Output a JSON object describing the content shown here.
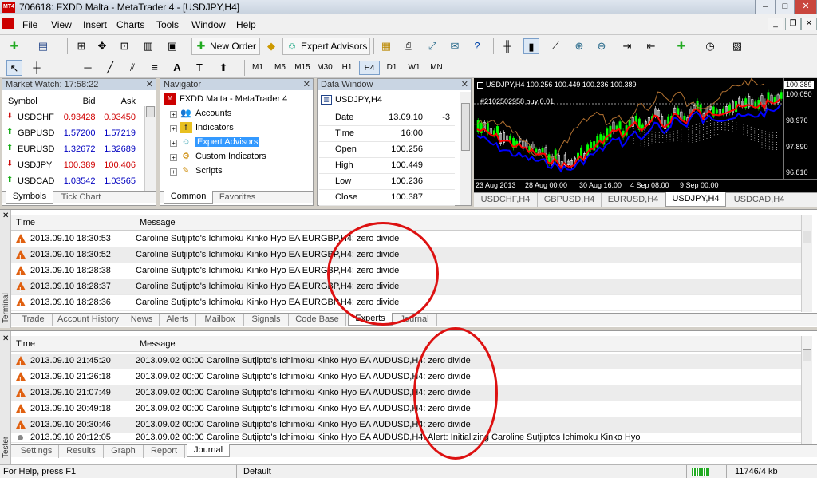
{
  "window": {
    "title": "706618: FXDD Malta - MetaTrader 4 - [USDJPY,H4]",
    "app_logo": "MT4"
  },
  "menu": [
    "File",
    "View",
    "Insert",
    "Charts",
    "Tools",
    "Window",
    "Help"
  ],
  "toolbar": {
    "new_order": "New Order",
    "expert_advisors": "Expert Advisors",
    "timeframes": [
      "M1",
      "M5",
      "M15",
      "M30",
      "H1",
      "H4",
      "D1",
      "W1",
      "MN"
    ],
    "selected_tf": "H4"
  },
  "market_watch": {
    "title": "Market Watch: 17:58:22",
    "headers": [
      "Symbol",
      "Bid",
      "Ask"
    ],
    "rows": [
      {
        "symbol": "USDCHF",
        "bid": "0.93428",
        "ask": "0.93450",
        "dir": "down"
      },
      {
        "symbol": "GBPUSD",
        "bid": "1.57200",
        "ask": "1.57219",
        "dir": "up"
      },
      {
        "symbol": "EURUSD",
        "bid": "1.32672",
        "ask": "1.32689",
        "dir": "up"
      },
      {
        "symbol": "USDJPY",
        "bid": "100.389",
        "ask": "100.406",
        "dir": "down"
      },
      {
        "symbol": "USDCAD",
        "bid": "1.03542",
        "ask": "1.03565",
        "dir": "up"
      }
    ],
    "tabs": [
      "Symbols",
      "Tick Chart"
    ]
  },
  "navigator": {
    "title": "Navigator",
    "root": "FXDD Malta - MetaTrader 4",
    "items": [
      "Accounts",
      "Indicators",
      "Expert Advisors",
      "Custom Indicators",
      "Scripts"
    ],
    "selected": "Expert Advisors",
    "tabs": [
      "Common",
      "Favorites"
    ]
  },
  "data_window": {
    "title": "Data Window",
    "symbol": "USDJPY,H4",
    "rows": [
      {
        "k": "Date",
        "v": "13.09.10",
        "v2": "-3"
      },
      {
        "k": "Time",
        "v": "16:00",
        "v2": ""
      },
      {
        "k": "Open",
        "v": "100.256",
        "v2": ""
      },
      {
        "k": "High",
        "v": "100.449",
        "v2": ""
      },
      {
        "k": "Low",
        "v": "100.236",
        "v2": ""
      },
      {
        "k": "Close",
        "v": "100.387",
        "v2": ""
      }
    ]
  },
  "chart": {
    "header": "USDJPY,H4  100.256 100.449 100.236 100.389",
    "order_label": "#2102502958 buy 0.01",
    "price_labels": [
      "100.389",
      "100.050",
      "98.970",
      "97.890",
      "96.810"
    ],
    "date_labels": [
      "23 Aug 2013",
      "28 Aug 00:00",
      "30 Aug 16:00",
      "4 Sep 08:00",
      "9 Sep 00:00"
    ],
    "tabs": [
      "USDCHF,H4",
      "GBPUSD,H4",
      "EURUSD,H4",
      "USDJPY,H4",
      "USDCAD,H4"
    ],
    "active_tab": "USDJPY,H4",
    "colors": {
      "bull": "#00ff00",
      "bear": "#ffffff",
      "tenkan": "#ff0000",
      "kijun": "#0000ff",
      "cloud": "#ffffff",
      "chikou": "#b07030"
    }
  },
  "terminal": {
    "label": "Terminal",
    "headers": [
      "Time",
      "Message"
    ],
    "rows": [
      {
        "time": "2013.09.10 18:30:53",
        "msg": "Caroline Sutjipto's Ichimoku Kinko Hyo EA EURGBP,H4: zero divide"
      },
      {
        "time": "2013.09.10 18:30:52",
        "msg": "Caroline Sutjipto's Ichimoku Kinko Hyo EA EURGBP,H4: zero divide"
      },
      {
        "time": "2013.09.10 18:28:38",
        "msg": "Caroline Sutjipto's Ichimoku Kinko Hyo EA EURGBP,H4: zero divide"
      },
      {
        "time": "2013.09.10 18:28:37",
        "msg": "Caroline Sutjipto's Ichimoku Kinko Hyo EA EURGBP,H4: zero divide"
      },
      {
        "time": "2013.09.10 18:28:36",
        "msg": "Caroline Sutjipto's Ichimoku Kinko Hyo EA EURGBP,H4: zero divide"
      }
    ],
    "tabs": [
      "Trade",
      "Account History",
      "News",
      "Alerts",
      "Mailbox",
      "Signals",
      "Code Base",
      "Experts",
      "Journal"
    ],
    "active_tab": "Experts"
  },
  "tester": {
    "label": "Tester",
    "headers": [
      "Time",
      "Message"
    ],
    "rows": [
      {
        "time": "2013.09.10 21:45:20",
        "msg": "2013.09.02 00:00   Caroline Sutjipto's Ichimoku Kinko Hyo EA AUDUSD,H4: zero divide",
        "type": "warn"
      },
      {
        "time": "2013.09.10 21:26:18",
        "msg": "2013.09.02 00:00   Caroline Sutjipto's Ichimoku Kinko Hyo EA AUDUSD,H4: zero divide",
        "type": "warn"
      },
      {
        "time": "2013.09.10 21:07:49",
        "msg": "2013.09.02 00:00   Caroline Sutjipto's Ichimoku Kinko Hyo EA AUDUSD,H4: zero divide",
        "type": "warn"
      },
      {
        "time": "2013.09.10 20:49:18",
        "msg": "2013.09.02 00:00   Caroline Sutjipto's Ichimoku Kinko Hyo EA AUDUSD,H4: zero divide",
        "type": "warn"
      },
      {
        "time": "2013.09.10 20:30:46",
        "msg": "2013.09.02 00:00   Caroline Sutjipto's Ichimoku Kinko Hyo EA AUDUSD,H4: zero divide",
        "type": "warn"
      },
      {
        "time": "2013.09.10 20:12:05",
        "msg": "2013.09.02 00:00   Caroline Sutjipto's Ichimoku Kinko Hyo EA AUDUSD,H4: Alert: Initializing Caroline Sutjiptos Ichimoku Kinko Hyo",
        "type": "info"
      }
    ],
    "tabs": [
      "Settings",
      "Results",
      "Graph",
      "Report",
      "Journal"
    ],
    "active_tab": "Journal"
  },
  "status": {
    "help": "For Help, press F1",
    "profile": "Default",
    "traffic": "11746/4 kb"
  }
}
